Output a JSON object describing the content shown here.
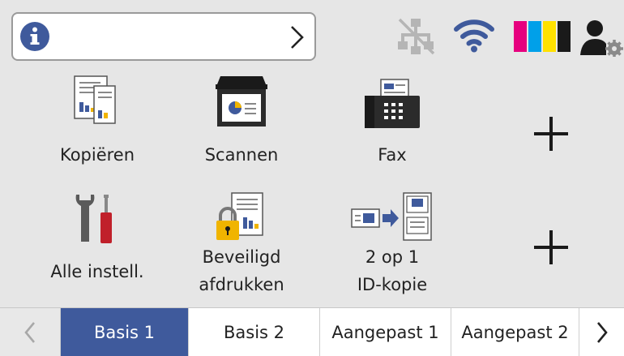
{
  "status_bar": {
    "info_icon": "info-icon",
    "expand_icon": "chevron-right-icon",
    "network_icon": "wired-lan-disconnected-icon",
    "wifi_icon": "wifi-icon",
    "ink_icon": "ink-cartridges-icon",
    "ink_colors": [
      "#e6007e",
      "#00a0e9",
      "#ffe100",
      "#1a1a1a"
    ],
    "user_icon": "user-settings-icon"
  },
  "tiles": {
    "kopieren": {
      "label": "Kopiëren",
      "icon": "copy-icon"
    },
    "scannen": {
      "label": "Scannen",
      "icon": "scan-icon"
    },
    "fax": {
      "label": "Fax",
      "icon": "fax-icon"
    },
    "instell": {
      "label": "Alle instell.",
      "icon": "settings-tools-icon"
    },
    "beveiligd": {
      "line1": "Beveiligd",
      "line2": "afdrukken",
      "icon": "secure-print-icon"
    },
    "id_kopie": {
      "line1": "2 op 1",
      "line2": "ID-kopie",
      "icon": "id-copy-icon"
    },
    "plus1": {
      "icon": "plus-icon"
    },
    "plus2": {
      "icon": "plus-icon"
    }
  },
  "tabs": {
    "basis1": "Basis 1",
    "basis2": "Basis 2",
    "aangepast1": "Aangepast 1",
    "aangepast2": "Aangepast 2",
    "active": "basis1"
  },
  "colors": {
    "accent": "#3f5a9c",
    "background": "#e6e6e6"
  }
}
